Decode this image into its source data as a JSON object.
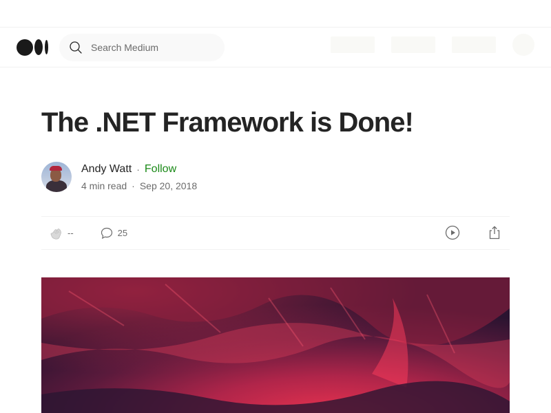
{
  "navbar": {
    "search": {
      "placeholder": "Search Medium"
    }
  },
  "article": {
    "title": "The .NET Framework is Done!",
    "author": {
      "name": "Andy Watt",
      "separator": "·",
      "follow_label": "Follow",
      "read_time": "4 min read",
      "date_separator": "·",
      "date": "Sep 20, 2018"
    },
    "actions": {
      "claps": "--",
      "comments": "25"
    }
  },
  "colors": {
    "follow": "#1a8917",
    "text": "#242424",
    "muted": "#6b6b6b"
  }
}
